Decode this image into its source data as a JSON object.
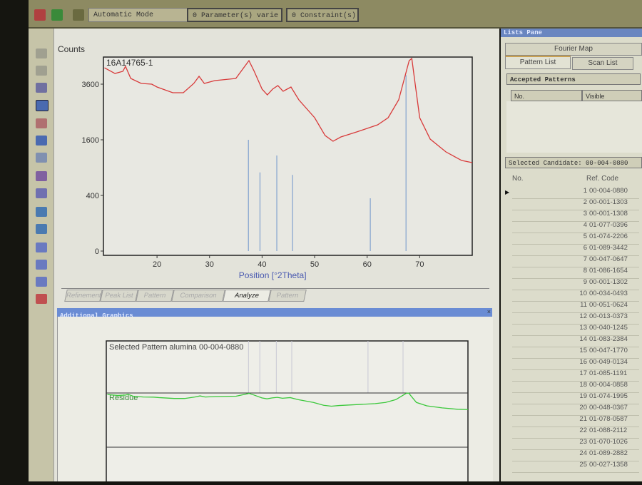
{
  "toolbar": {
    "mode": "Automatic Mode",
    "parameters": "0 Parameter(s) varie",
    "constraints": "0 Constraint(s)"
  },
  "main_chart": {
    "y_label": "Counts",
    "x_label": "Position [°2Theta]",
    "scan_name": "16A14765-1",
    "y_ticks": [
      0,
      400,
      1600,
      3600
    ],
    "x_ticks": [
      20,
      30,
      40,
      50,
      60,
      70
    ],
    "xlim": [
      9.8,
      80
    ],
    "y_scale": "sqrt",
    "series": {
      "name": "16A14765-1",
      "color": "#d83a3a",
      "points": [
        [
          10,
          4342
        ],
        [
          12,
          4076
        ],
        [
          13.5,
          4175
        ],
        [
          14,
          4410
        ],
        [
          15,
          3850
        ],
        [
          17,
          3631
        ],
        [
          19,
          3600
        ],
        [
          20,
          3478
        ],
        [
          23,
          3240
        ],
        [
          25,
          3240
        ],
        [
          27,
          3631
        ],
        [
          28,
          3946
        ],
        [
          29,
          3631
        ],
        [
          31,
          3756
        ],
        [
          35,
          3850
        ],
        [
          37.5,
          4687
        ],
        [
          38.5,
          4175
        ],
        [
          40,
          3388
        ],
        [
          41,
          3153
        ],
        [
          42,
          3388
        ],
        [
          43,
          3539
        ],
        [
          44,
          3299
        ],
        [
          45.5,
          3478
        ],
        [
          47,
          2955
        ],
        [
          50,
          2299
        ],
        [
          52,
          1725
        ],
        [
          53.5,
          1559
        ],
        [
          55,
          1683
        ],
        [
          58,
          1834
        ],
        [
          62,
          2060
        ],
        [
          64,
          2299
        ],
        [
          66,
          2955
        ],
        [
          68,
          4687
        ],
        [
          68.5,
          4793
        ],
        [
          69,
          3850
        ],
        [
          70,
          2299
        ],
        [
          72,
          1620
        ],
        [
          75,
          1270
        ],
        [
          78,
          1060
        ],
        [
          80,
          1011
        ]
      ]
    },
    "reference_sticks": {
      "color": "#8aa8d0",
      "points": [
        [
          37.4,
          1600
        ],
        [
          39.6,
          800
        ],
        [
          42.8,
          1180
        ],
        [
          45.8,
          750
        ],
        [
          60.6,
          360
        ],
        [
          67.4,
          4000
        ]
      ]
    }
  },
  "bottom_tabs": [
    "Refinement",
    "Peak List",
    "Pattern",
    "Comparison",
    "Analyze",
    "Pattern"
  ],
  "active_bottom_tab": "Analyze",
  "additional_graphics": {
    "title": "Additional Graphics",
    "selected_pattern": "Selected Pattern  alumina  00-004-0880",
    "residue_label": "Residue",
    "residue_color": "#3cc83c"
  },
  "lists_pane": {
    "title": "Lists Pane",
    "tabs_top": [
      "Fourier Map"
    ],
    "tabs": [
      "Pattern List",
      "Scan List"
    ],
    "accepted_title": "Accepted Patterns",
    "accepted_cols": [
      "No.",
      "Visible"
    ],
    "selected_candidate": "Selected Candidate:  00-004-0880",
    "cols": [
      "No.",
      "Ref. Code"
    ],
    "rows": [
      [
        "1",
        "00-004-0880"
      ],
      [
        "2",
        "00-001-1303"
      ],
      [
        "3",
        "00-001-1308"
      ],
      [
        "4",
        "01-077-0396"
      ],
      [
        "5",
        "01-074-2206"
      ],
      [
        "6",
        "01-089-3442"
      ],
      [
        "7",
        "00-047-0647"
      ],
      [
        "8",
        "01-086-1654"
      ],
      [
        "9",
        "00-001-1302"
      ],
      [
        "10",
        "00-034-0493"
      ],
      [
        "11",
        "00-051-0624"
      ],
      [
        "12",
        "00-013-0373"
      ],
      [
        "13",
        "00-040-1245"
      ],
      [
        "14",
        "01-083-2384"
      ],
      [
        "15",
        "00-047-1770"
      ],
      [
        "16",
        "00-049-0134"
      ],
      [
        "17",
        "01-085-1191"
      ],
      [
        "18",
        "00-004-0858"
      ],
      [
        "19",
        "01-074-1995"
      ],
      [
        "20",
        "00-048-0367"
      ],
      [
        "21",
        "01-078-0587"
      ],
      [
        "22",
        "01-088-2112"
      ],
      [
        "23",
        "01-070-1026"
      ],
      [
        "24",
        "01-089-2882"
      ],
      [
        "25",
        "00-027-1358"
      ]
    ]
  }
}
